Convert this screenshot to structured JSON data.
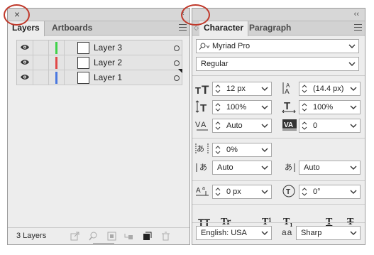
{
  "layers_panel": {
    "close_glyph": "×",
    "collapse_glyph": "‹",
    "tabs": [
      {
        "label": "Layers",
        "active": true
      },
      {
        "label": "Artboards",
        "active": false
      }
    ],
    "layers": [
      {
        "name": "Layer 3",
        "color": "#3fd24a"
      },
      {
        "name": "Layer 2",
        "color": "#e04848"
      },
      {
        "name": "Layer 1",
        "color": "#4a78e0"
      }
    ],
    "footer_count": "3 Layers",
    "footer_icons": [
      "export-icon",
      "search-icon",
      "clip-mask-icon",
      "sublayer-icon",
      "new-layer-icon",
      "delete-icon"
    ]
  },
  "character_panel": {
    "collapse_glyph": "‹‹",
    "tabs": [
      {
        "label": "Character",
        "active": true
      },
      {
        "label": "Paragraph",
        "active": false
      }
    ],
    "font_family": "Myriad Pro",
    "font_style": "Regular",
    "font_size": "12 px",
    "leading": "(14.4 px)",
    "vertical_scale": "100%",
    "horizontal_scale": "100%",
    "kerning": "Auto",
    "tracking": "0",
    "tsume": "0%",
    "aki_left": "Auto",
    "aki_right": "Auto",
    "baseline_shift": "0 px",
    "rotation": "0°",
    "glyph_buttons": {
      "all_caps": "TT",
      "small_caps": "Tr",
      "superscript": "T¹",
      "subscript": "T₁",
      "underline": "T",
      "strikethrough": "T"
    },
    "language": "English: USA",
    "antialias_icon_label": "aa",
    "antialias": "Sharp"
  },
  "annotation_color": "#c0392b"
}
